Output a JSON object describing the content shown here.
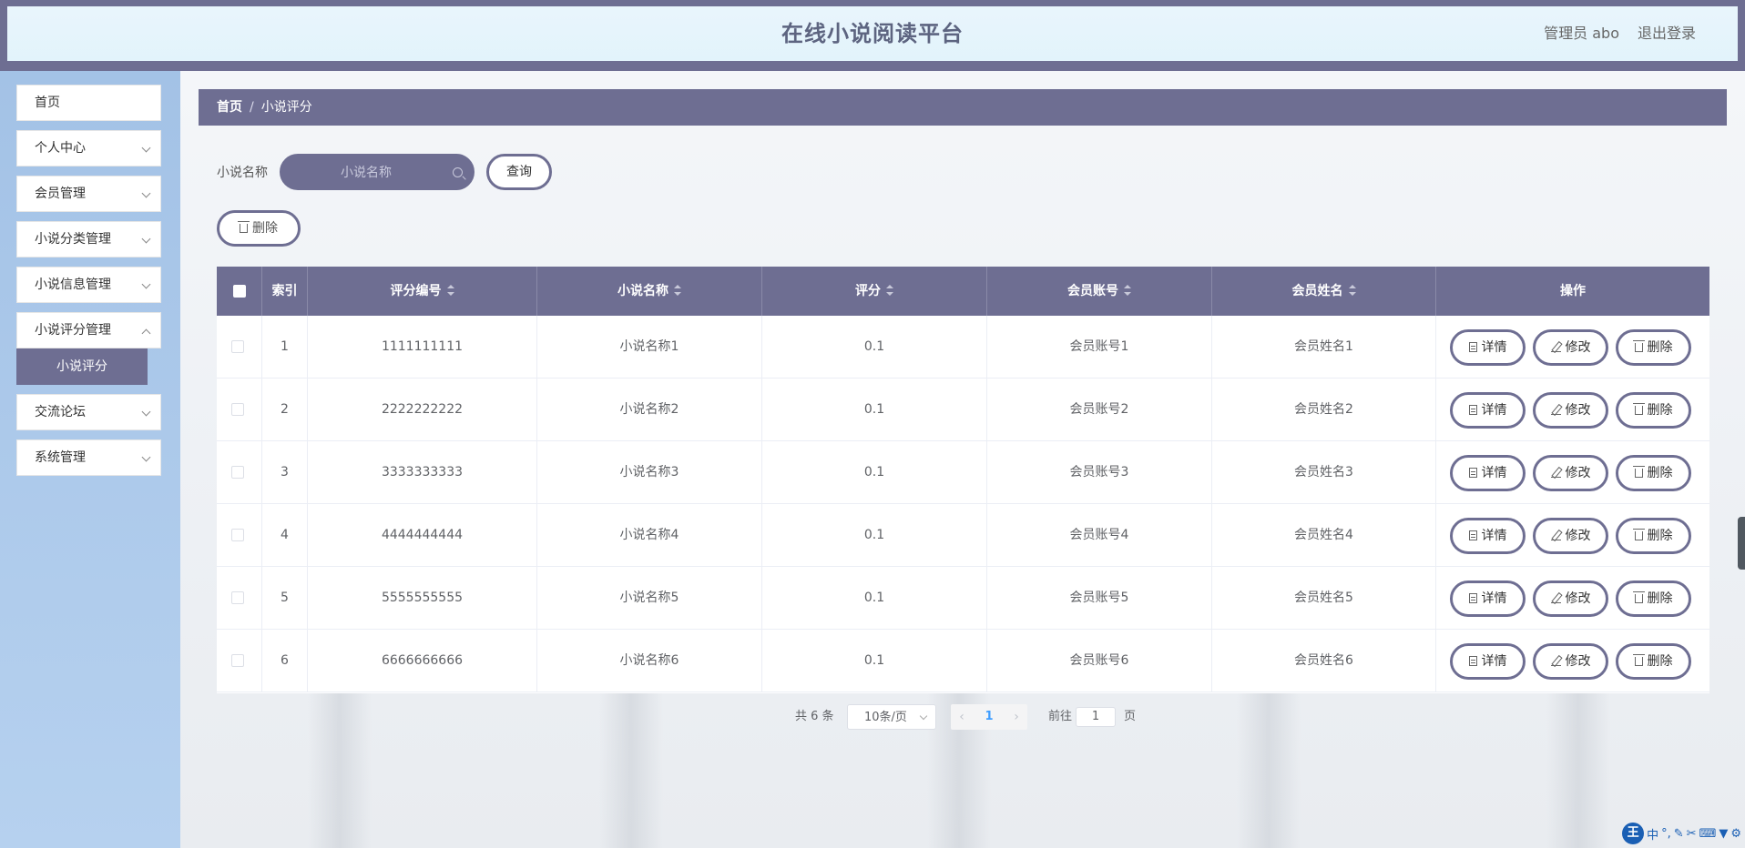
{
  "header": {
    "title": "在线小说阅读平台",
    "user": "管理员 abo",
    "logout": "退出登录"
  },
  "sidebar": {
    "items": [
      {
        "label": "首页"
      },
      {
        "label": "个人中心"
      },
      {
        "label": "会员管理"
      },
      {
        "label": "小说分类管理"
      },
      {
        "label": "小说信息管理"
      },
      {
        "label": "小说评分管理"
      },
      {
        "label": "交流论坛"
      },
      {
        "label": "系统管理"
      }
    ],
    "active_sub": "小说评分"
  },
  "breadcrumb": {
    "home": "首页",
    "separator": "/",
    "current": "小说评分"
  },
  "search": {
    "label": "小说名称",
    "placeholder": "小说名称",
    "query_button": "查询"
  },
  "toolbar": {
    "delete_label": "删除"
  },
  "table": {
    "columns": [
      "索引",
      "评分编号",
      "小说名称",
      "评分",
      "会员账号",
      "会员姓名",
      "操作"
    ],
    "rows": [
      {
        "index": "1",
        "code": "1111111111",
        "name": "小说名称1",
        "score": "0.1",
        "account": "会员账号1",
        "member": "会员姓名1"
      },
      {
        "index": "2",
        "code": "2222222222",
        "name": "小说名称2",
        "score": "0.1",
        "account": "会员账号2",
        "member": "会员姓名2"
      },
      {
        "index": "3",
        "code": "3333333333",
        "name": "小说名称3",
        "score": "0.1",
        "account": "会员账号3",
        "member": "会员姓名3"
      },
      {
        "index": "4",
        "code": "4444444444",
        "name": "小说名称4",
        "score": "0.1",
        "account": "会员账号4",
        "member": "会员姓名4"
      },
      {
        "index": "5",
        "code": "5555555555",
        "name": "小说名称5",
        "score": "0.1",
        "account": "会员账号5",
        "member": "会员姓名5"
      },
      {
        "index": "6",
        "code": "6666666666",
        "name": "小说名称6",
        "score": "0.1",
        "account": "会员账号6",
        "member": "会员姓名6"
      }
    ],
    "actions": {
      "detail": "详情",
      "edit": "修改",
      "delete": "删除"
    }
  },
  "pagination": {
    "total": "共 6 条",
    "page_size": "10条/页",
    "current_page": "1",
    "goto_label": "前往",
    "goto_value": "1",
    "page_suffix": "页"
  },
  "ime": {
    "badge": "王",
    "mode": "中"
  },
  "colors": {
    "accent": "#6e6e92",
    "sidebar_bg": "#a9c7e9",
    "header_bg": "#e5f4fb"
  }
}
